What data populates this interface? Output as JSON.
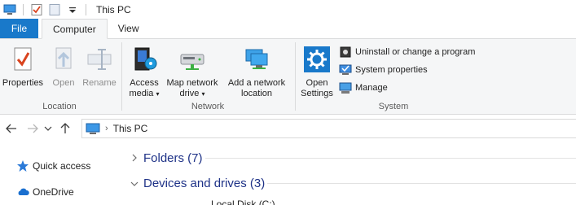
{
  "window": {
    "title": "This PC"
  },
  "ribbon_tabs": [
    {
      "label": "File"
    },
    {
      "label": "Computer"
    },
    {
      "label": "View"
    }
  ],
  "ribbon": {
    "location": {
      "label": "Location",
      "properties": "Properties",
      "open": "Open",
      "rename": "Rename"
    },
    "network": {
      "label": "Network",
      "access_media_l1": "Access",
      "access_media_l2": "media",
      "map_drive_l1": "Map network",
      "map_drive_l2": "drive",
      "add_location_l1": "Add a network",
      "add_location_l2": "location"
    },
    "system": {
      "label": "System",
      "open_settings_l1": "Open",
      "open_settings_l2": "Settings",
      "uninstall": "Uninstall or change a program",
      "system_properties": "System properties",
      "manage": "Manage"
    }
  },
  "address_bar": {
    "separator": "›",
    "path": "This PC"
  },
  "nav_pane": {
    "items": [
      {
        "label": "Quick access",
        "icon": "star-icon"
      },
      {
        "label": "OneDrive",
        "icon": "cloud-icon"
      }
    ]
  },
  "content": {
    "folders": "Folders (7)",
    "devices": "Devices and drives (3)",
    "partial_drive": "Local Disk (C:)"
  },
  "colors": {
    "file_tab": "#1979ca",
    "ribbon_bg": "#f5f6f7",
    "section_title": "#1e3287"
  }
}
